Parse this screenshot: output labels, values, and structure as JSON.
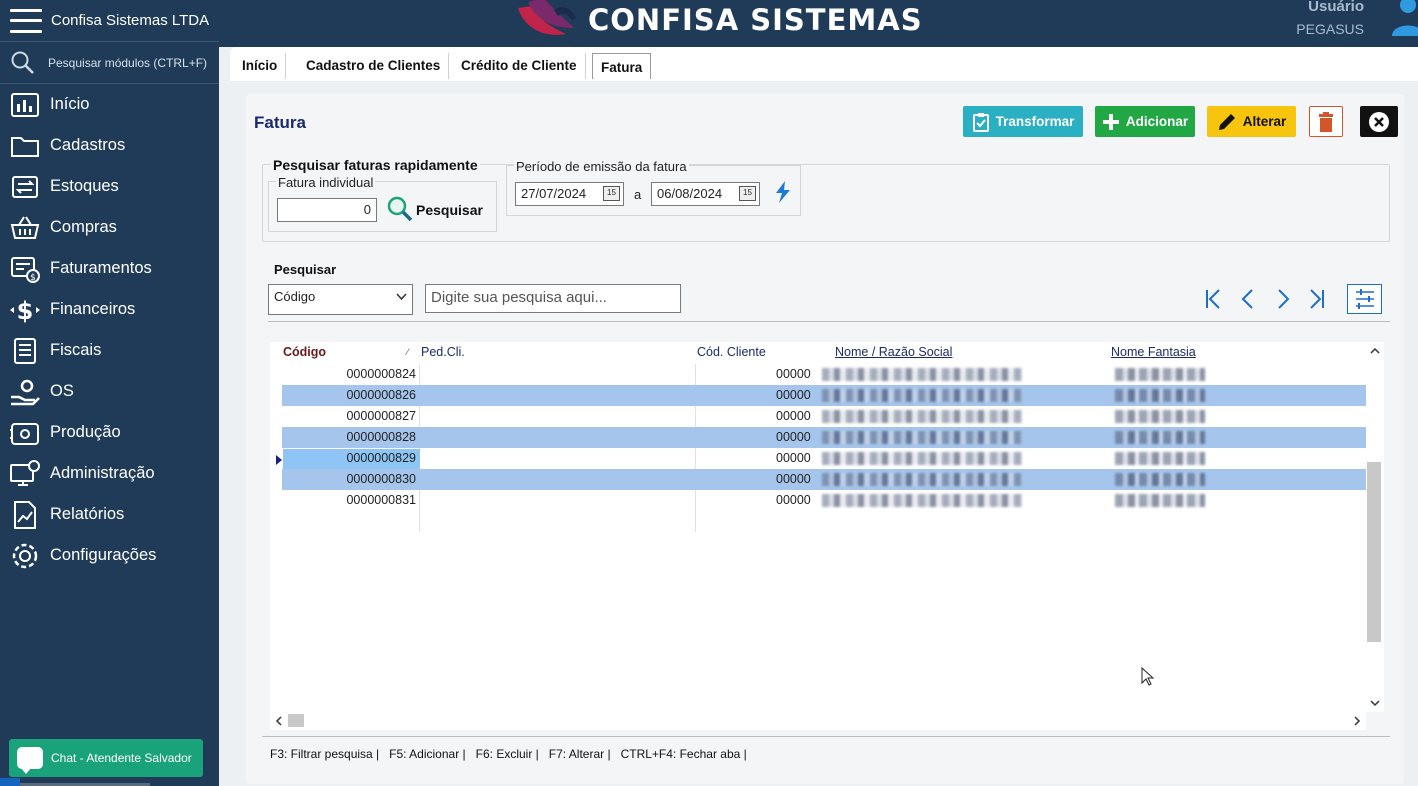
{
  "app": {
    "company": "Confisa Sistemas LTDA",
    "logo_text": "CONFISA SISTEMAS",
    "user_label": "Usuário",
    "user_name": "PEGASUS"
  },
  "sidebar": {
    "search_placeholder": "Pesquisar módulos (CTRL+F)",
    "items": [
      {
        "label": "Início",
        "icon": "chart-icon"
      },
      {
        "label": "Cadastros",
        "icon": "folder-icon"
      },
      {
        "label": "Estoques",
        "icon": "transfer-icon"
      },
      {
        "label": "Compras",
        "icon": "basket-icon"
      },
      {
        "label": "Faturamentos",
        "icon": "invoice-icon"
      },
      {
        "label": "Financeiros",
        "icon": "dollar-icon"
      },
      {
        "label": "Fiscais",
        "icon": "list-icon"
      },
      {
        "label": "OS",
        "icon": "hand-gear-icon"
      },
      {
        "label": "Produção",
        "icon": "factory-icon"
      },
      {
        "label": "Administração",
        "icon": "monitor-gear-icon"
      },
      {
        "label": "Relatórios",
        "icon": "report-icon"
      },
      {
        "label": "Configurações",
        "icon": "gear-icon"
      }
    ],
    "chat_label": "Chat - Atendente Salvador"
  },
  "tabs": [
    {
      "label": "Início"
    },
    {
      "label": "Cadastro de Clientes"
    },
    {
      "label": "Crédito de Cliente"
    },
    {
      "label": "Fatura"
    }
  ],
  "panel": {
    "title": "Fatura",
    "buttons": {
      "transformar": "Transformar",
      "adicionar": "Adicionar",
      "alterar": "Alterar"
    },
    "quick_search": {
      "legend": "Pesquisar faturas rapidamente",
      "individual_legend": "Fatura individual",
      "individual_value": "0",
      "search_label": "Pesquisar",
      "period_legend": "Período de emissão da fatura",
      "date_from": "27/07/2024",
      "date_sep": "a",
      "date_to": "06/08/2024"
    },
    "filter": {
      "label": "Pesquisar",
      "field_selected": "Código",
      "placeholder": "Digite sua pesquisa aqui..."
    },
    "grid": {
      "columns": [
        "Código",
        "Ped.Cli.",
        "Cód. Cliente",
        "Nome / Razão Social",
        "Nome Fantasia"
      ],
      "rows": [
        {
          "codigo": "0000000824",
          "cod_cliente": "00000"
        },
        {
          "codigo": "0000000826",
          "cod_cliente": "00000"
        },
        {
          "codigo": "0000000827",
          "cod_cliente": "00000"
        },
        {
          "codigo": "0000000828",
          "cod_cliente": "00000"
        },
        {
          "codigo": "0000000829",
          "cod_cliente": "00000"
        },
        {
          "codigo": "0000000830",
          "cod_cliente": "00000"
        },
        {
          "codigo": "0000000831",
          "cod_cliente": "00000"
        }
      ]
    },
    "shortcuts": "F3: Filtrar pesquisa |   F5: Adicionar |   F6: Excluir |   F7: Alterar |   CTRL+F4: Fechar aba |"
  },
  "colors": {
    "sidebar_bg": "#1f3b57",
    "selected_row": "#a5c5ec",
    "transformar": "#2ab0c2",
    "adicionar": "#22a745",
    "alterar": "#f8c50e",
    "chat": "#1aa37a"
  }
}
